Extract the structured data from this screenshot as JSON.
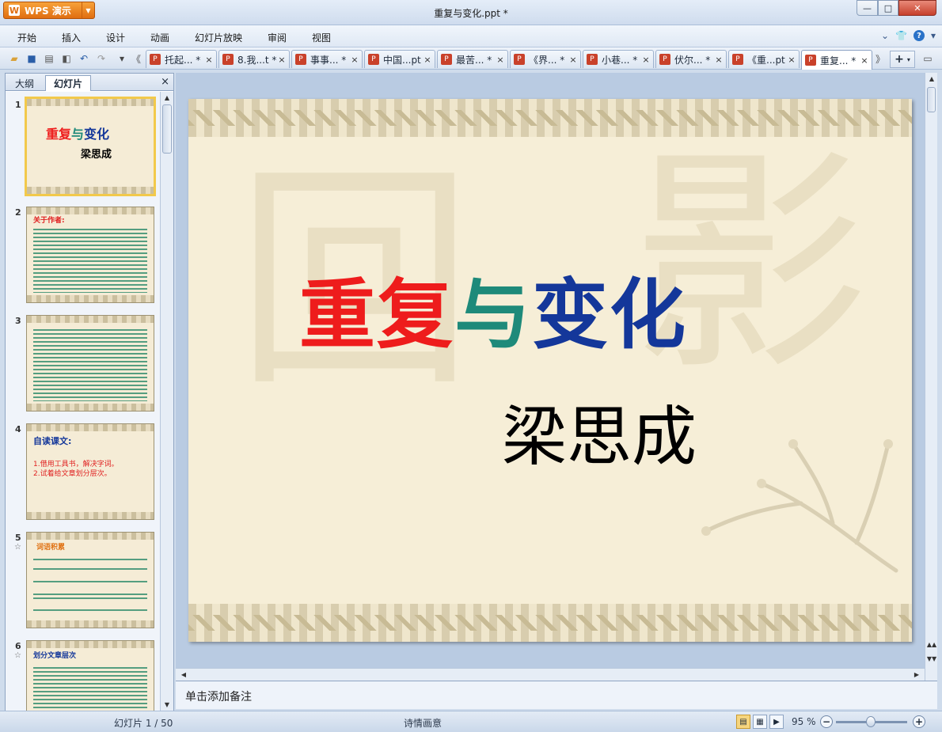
{
  "app": {
    "name": "WPS 演示",
    "logo_letter": "W"
  },
  "window": {
    "title": "重复与变化.ppt *",
    "minimize": "—",
    "maximize": "□",
    "close": "✕"
  },
  "menu": {
    "items": [
      "开始",
      "插入",
      "设计",
      "动画",
      "幻灯片放映",
      "审阅",
      "视图"
    ]
  },
  "toolbar": {
    "icons": [
      "open-folder-icon",
      "save-icon",
      "print-icon",
      "print-preview-icon",
      "undo-icon",
      "redo-icon",
      "customize-icon",
      "tabs-left-icon"
    ]
  },
  "tabs": [
    {
      "label": "托起... *"
    },
    {
      "label": "8.我...t *"
    },
    {
      "label": "事事... *"
    },
    {
      "label": "中国...pt"
    },
    {
      "label": "最苦... *"
    },
    {
      "label": "《界... *"
    },
    {
      "label": "小巷... *"
    },
    {
      "label": "伏尔... *"
    },
    {
      "label": "《重...pt"
    },
    {
      "label": "重复... *",
      "active": true
    }
  ],
  "tab_close": "×",
  "tab_new": "+",
  "panel": {
    "tab_outline": "大纲",
    "tab_slides": "幻灯片",
    "close": "×"
  },
  "thumbs": [
    {
      "num": "1",
      "title_red": "重复",
      "title_teal": "与",
      "title_blue": "变化",
      "author": "梁思成"
    },
    {
      "num": "2",
      "heading": "关于作者:"
    },
    {
      "num": "3"
    },
    {
      "num": "4",
      "heading": "自读课文:",
      "line1": "1.借用工具书，解决字词。",
      "line2": "2.试着给文章划分层次。"
    },
    {
      "num": "5",
      "star": "☆",
      "heading": "词语积累"
    },
    {
      "num": "6",
      "star": "☆",
      "heading": "划分文章层次"
    }
  ],
  "slide": {
    "title_part1": "重复",
    "title_part2": "与",
    "title_part3": "变化",
    "subtitle": "梁思成"
  },
  "notes": {
    "placeholder": "单击添加备注"
  },
  "status": {
    "slide_indicator": "幻灯片 1 / 50",
    "theme": "诗情画意",
    "zoom": "95 %"
  },
  "colors": {
    "red": "#ee1c1c",
    "teal": "#1e8a7a",
    "blue": "#14379a"
  }
}
